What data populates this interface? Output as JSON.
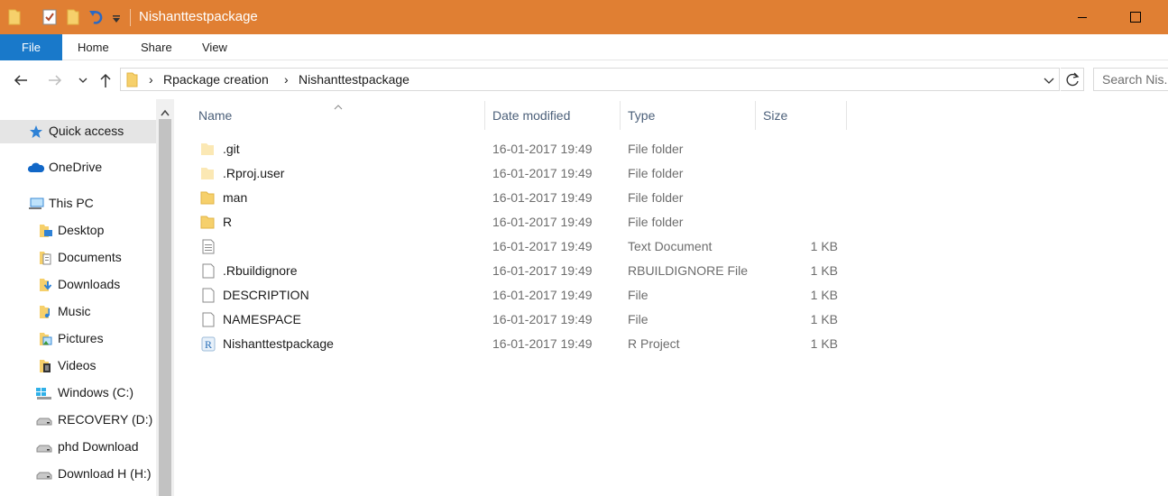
{
  "window": {
    "title": "Nishanttestpackage",
    "accent": "#e07f33"
  },
  "ribbon": {
    "file_label": "File",
    "tabs": [
      "Home",
      "Share",
      "View"
    ]
  },
  "address": {
    "breadcrumbs": [
      "Rpackage creation",
      "Nishanttestpackage"
    ]
  },
  "search": {
    "placeholder": "Search Nis..."
  },
  "sidebar": {
    "items": [
      {
        "label": "Quick access",
        "icon": "star-icon",
        "selected": true
      },
      {
        "label": "OneDrive",
        "icon": "cloud-icon"
      },
      {
        "label": "This PC",
        "icon": "computer-icon"
      },
      {
        "label": "Desktop",
        "icon": "desktop-folder-icon"
      },
      {
        "label": "Documents",
        "icon": "documents-folder-icon"
      },
      {
        "label": "Downloads",
        "icon": "downloads-folder-icon"
      },
      {
        "label": "Music",
        "icon": "music-folder-icon"
      },
      {
        "label": "Pictures",
        "icon": "pictures-folder-icon"
      },
      {
        "label": "Videos",
        "icon": "videos-folder-icon"
      },
      {
        "label": "Windows (C:)",
        "icon": "windows-drive-icon"
      },
      {
        "label": "RECOVERY (D:)",
        "icon": "drive-icon"
      },
      {
        "label": "phd Download",
        "icon": "drive-icon"
      },
      {
        "label": "Download H (H:)",
        "icon": "drive-icon"
      }
    ]
  },
  "columns": {
    "name": "Name",
    "date": "Date modified",
    "type": "Type",
    "size": "Size"
  },
  "files": [
    {
      "name": ".git",
      "date": "16-01-2017 19:49",
      "type": "File folder",
      "size": "",
      "icon": "faded-folder-icon"
    },
    {
      "name": ".Rproj.user",
      "date": "16-01-2017 19:49",
      "type": "File folder",
      "size": "",
      "icon": "faded-folder-icon"
    },
    {
      "name": "man",
      "date": "16-01-2017 19:49",
      "type": "File folder",
      "size": "",
      "icon": "folder-icon"
    },
    {
      "name": "R",
      "date": "16-01-2017 19:49",
      "type": "File folder",
      "size": "",
      "icon": "folder-icon"
    },
    {
      "name": "",
      "date": "16-01-2017 19:49",
      "type": "Text Document",
      "size": "1 KB",
      "icon": "text-document-icon"
    },
    {
      "name": ".Rbuildignore",
      "date": "16-01-2017 19:49",
      "type": "RBUILDIGNORE File",
      "size": "1 KB",
      "icon": "file-icon"
    },
    {
      "name": "DESCRIPTION",
      "date": "16-01-2017 19:49",
      "type": "File",
      "size": "1 KB",
      "icon": "file-icon"
    },
    {
      "name": "NAMESPACE",
      "date": "16-01-2017 19:49",
      "type": "File",
      "size": "1 KB",
      "icon": "file-icon"
    },
    {
      "name": "Nishanttestpackage",
      "date": "16-01-2017 19:49",
      "type": "R Project",
      "size": "1 KB",
      "icon": "r-project-icon"
    }
  ]
}
